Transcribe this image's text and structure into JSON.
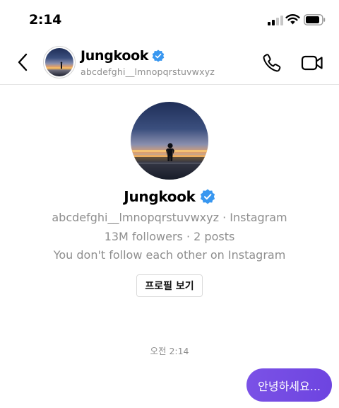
{
  "status_bar": {
    "time": "2:14"
  },
  "header": {
    "name": "Jungkook",
    "username": "abcdefghi__lmnopqrstuvwxyz",
    "verified": true
  },
  "profile": {
    "name": "Jungkook",
    "handle_line": "abcdefghi__lmnopqrstuvwxyz · Instagram",
    "stats_line": "13M followers · 2 posts",
    "follow_line": "You don't follow each other on Instagram",
    "view_profile_label": "프로필 보기"
  },
  "conversation": {
    "timestamp": "오전 2:14",
    "messages": [
      {
        "from": "me",
        "text": "안녕하세요..."
      }
    ]
  },
  "colors": {
    "accent": "#7b52e6",
    "verified": "#3897f0",
    "muted_text": "#8e8e8e"
  },
  "icons": [
    "signal-icon",
    "wifi-icon",
    "battery-icon",
    "back-chevron-icon",
    "verified-badge-icon",
    "phone-icon",
    "video-camera-icon"
  ]
}
